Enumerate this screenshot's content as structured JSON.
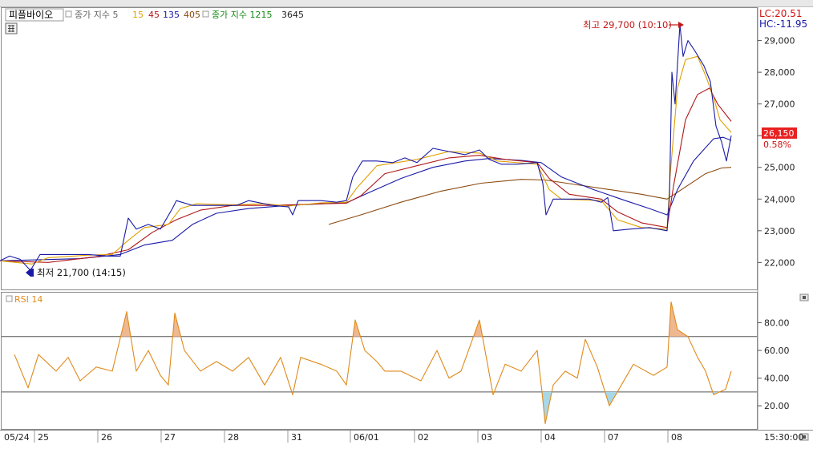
{
  "legend": {
    "toggle_icon": "grid-toggle-icon",
    "filter_label": "피플바이오",
    "sma_label": "종가 지수 5",
    "sma_periods": [
      {
        "value": "15",
        "color": "#e0a000"
      },
      {
        "value": "45",
        "color": "#b01818"
      },
      {
        "value": "135",
        "color": "#1a1aa8"
      },
      {
        "value": "405",
        "color": "#8a4a10"
      }
    ],
    "sma2_label": "종가 지수 1215",
    "sma2_period": "3645"
  },
  "right_panel": {
    "lc": "LC:20.51",
    "hc": "HC:-11.95",
    "current_price": "26,150",
    "current_change": "0.58%"
  },
  "markers": {
    "high": "최고 29,700 (10:10)",
    "low": "최저 21,700 (14:15)"
  },
  "rsi_panel": {
    "label": "RSI 14"
  },
  "time_axis": {
    "end_label": "15:30:00",
    "labels": [
      "05/24",
      "25",
      "26",
      "27",
      "28",
      "31",
      "06/01",
      "02",
      "03",
      "04",
      "07",
      "08"
    ]
  },
  "chart_data": {
    "type": "line",
    "series": [
      {
        "name": "종가",
        "color": "#1a1aa8",
        "points": [
          [
            0,
            22050
          ],
          [
            12,
            22200
          ],
          [
            25,
            22100
          ],
          [
            38,
            21750
          ],
          [
            50,
            22250
          ],
          [
            80,
            22250
          ],
          [
            110,
            22250
          ],
          [
            135,
            22200
          ],
          [
            150,
            22200
          ],
          [
            160,
            23400
          ],
          [
            170,
            23050
          ],
          [
            185,
            23200
          ],
          [
            200,
            23050
          ],
          [
            215,
            23700
          ],
          [
            220,
            23950
          ],
          [
            240,
            23800
          ],
          [
            270,
            23800
          ],
          [
            295,
            23800
          ],
          [
            310,
            23950
          ],
          [
            340,
            23800
          ],
          [
            360,
            23750
          ],
          [
            365,
            23500
          ],
          [
            372,
            23950
          ],
          [
            400,
            23950
          ],
          [
            420,
            23900
          ],
          [
            432,
            23950
          ],
          [
            440,
            24700
          ],
          [
            452,
            25200
          ],
          [
            470,
            25200
          ],
          [
            490,
            25150
          ],
          [
            505,
            25300
          ],
          [
            520,
            25150
          ],
          [
            540,
            25600
          ],
          [
            560,
            25500
          ],
          [
            580,
            25400
          ],
          [
            598,
            25550
          ],
          [
            610,
            25250
          ],
          [
            625,
            25100
          ],
          [
            645,
            25100
          ],
          [
            670,
            25150
          ],
          [
            677,
            24500
          ],
          [
            681,
            23500
          ],
          [
            690,
            24000
          ],
          [
            720,
            24000
          ],
          [
            735,
            24000
          ],
          [
            750,
            23900
          ],
          [
            758,
            24050
          ],
          [
            765,
            23000
          ],
          [
            785,
            23050
          ],
          [
            810,
            23100
          ],
          [
            832,
            23000
          ],
          [
            835,
            24100
          ],
          [
            838,
            28000
          ],
          [
            842,
            27000
          ],
          [
            848,
            29500
          ],
          [
            852,
            28500
          ],
          [
            858,
            29000
          ],
          [
            866,
            28700
          ],
          [
            878,
            28200
          ],
          [
            886,
            27700
          ],
          [
            893,
            26300
          ],
          [
            900,
            25800
          ],
          [
            906,
            25200
          ],
          [
            912,
            26000
          ]
        ]
      },
      {
        "name": "15",
        "color": "#e0a000",
        "points": [
          [
            0,
            22050
          ],
          [
            40,
            21950
          ],
          [
            60,
            22150
          ],
          [
            110,
            22230
          ],
          [
            140,
            22250
          ],
          [
            160,
            22700
          ],
          [
            180,
            23100
          ],
          [
            210,
            23200
          ],
          [
            225,
            23700
          ],
          [
            245,
            23850
          ],
          [
            290,
            23820
          ],
          [
            330,
            23850
          ],
          [
            360,
            23780
          ],
          [
            400,
            23880
          ],
          [
            432,
            23900
          ],
          [
            445,
            24350
          ],
          [
            470,
            25050
          ],
          [
            520,
            25250
          ],
          [
            560,
            25500
          ],
          [
            598,
            25450
          ],
          [
            620,
            25200
          ],
          [
            670,
            25100
          ],
          [
            685,
            24300
          ],
          [
            700,
            24000
          ],
          [
            750,
            23950
          ],
          [
            770,
            23350
          ],
          [
            800,
            23100
          ],
          [
            832,
            23050
          ],
          [
            836,
            24800
          ],
          [
            845,
            27500
          ],
          [
            855,
            28400
          ],
          [
            870,
            28500
          ],
          [
            880,
            27900
          ],
          [
            890,
            27200
          ],
          [
            898,
            26500
          ],
          [
            912,
            26100
          ]
        ]
      },
      {
        "name": "45",
        "color": "#b01818",
        "points": [
          [
            0,
            22050
          ],
          [
            60,
            22000
          ],
          [
            120,
            22180
          ],
          [
            160,
            22400
          ],
          [
            190,
            22950
          ],
          [
            220,
            23350
          ],
          [
            250,
            23650
          ],
          [
            290,
            23800
          ],
          [
            340,
            23800
          ],
          [
            400,
            23850
          ],
          [
            432,
            23870
          ],
          [
            450,
            24100
          ],
          [
            480,
            24800
          ],
          [
            520,
            25050
          ],
          [
            560,
            25300
          ],
          [
            598,
            25380
          ],
          [
            630,
            25250
          ],
          [
            670,
            25150
          ],
          [
            685,
            24650
          ],
          [
            710,
            24150
          ],
          [
            750,
            24000
          ],
          [
            770,
            23600
          ],
          [
            800,
            23250
          ],
          [
            832,
            23100
          ],
          [
            840,
            24400
          ],
          [
            855,
            26500
          ],
          [
            870,
            27300
          ],
          [
            885,
            27500
          ],
          [
            895,
            27000
          ],
          [
            912,
            26450
          ]
        ]
      },
      {
        "name": "135",
        "color": "#1a1aa8",
        "points": [
          [
            0,
            22050
          ],
          [
            100,
            22120
          ],
          [
            150,
            22250
          ],
          [
            180,
            22550
          ],
          [
            215,
            22700
          ],
          [
            240,
            23200
          ],
          [
            270,
            23550
          ],
          [
            310,
            23700
          ],
          [
            360,
            23800
          ],
          [
            400,
            23850
          ],
          [
            432,
            23880
          ],
          [
            460,
            24200
          ],
          [
            500,
            24650
          ],
          [
            540,
            25000
          ],
          [
            580,
            25200
          ],
          [
            610,
            25280
          ],
          [
            650,
            25220
          ],
          [
            675,
            25150
          ],
          [
            700,
            24700
          ],
          [
            740,
            24300
          ],
          [
            780,
            23950
          ],
          [
            810,
            23700
          ],
          [
            832,
            23500
          ],
          [
            845,
            24300
          ],
          [
            865,
            25200
          ],
          [
            890,
            25900
          ],
          [
            902,
            25950
          ],
          [
            912,
            25850
          ]
        ]
      },
      {
        "name": "405",
        "color": "#8a4a10",
        "points": [
          [
            410,
            23200
          ],
          [
            450,
            23500
          ],
          [
            500,
            23900
          ],
          [
            550,
            24250
          ],
          [
            600,
            24500
          ],
          [
            650,
            24620
          ],
          [
            680,
            24600
          ],
          [
            720,
            24450
          ],
          [
            760,
            24300
          ],
          [
            800,
            24150
          ],
          [
            832,
            24000
          ],
          [
            850,
            24300
          ],
          [
            880,
            24800
          ],
          [
            900,
            24980
          ],
          [
            912,
            25000
          ]
        ]
      }
    ],
    "y_axis": {
      "ticks": [
        22000,
        23000,
        24000,
        25000,
        26000,
        27000,
        28000,
        29000
      ],
      "tick_labels": [
        "22,000",
        "23,000",
        "24,000",
        "25,000",
        "26,000",
        "27,000",
        "28,000",
        "29,000"
      ],
      "ylim": [
        21300,
        29900
      ]
    },
    "rsi": {
      "name": "RSI 14",
      "color": "#e08a1a",
      "ylim": [
        5,
        100
      ],
      "overbought": 70,
      "oversold": 30,
      "ticks": [
        20,
        40,
        60,
        80
      ],
      "tick_labels": [
        "20.00",
        "40.00",
        "60.00",
        "80.00"
      ],
      "points": [
        [
          18,
          57
        ],
        [
          35,
          33
        ],
        [
          48,
          57
        ],
        [
          70,
          45
        ],
        [
          85,
          55
        ],
        [
          100,
          38
        ],
        [
          120,
          48
        ],
        [
          140,
          45
        ],
        [
          158,
          88
        ],
        [
          170,
          45
        ],
        [
          185,
          60
        ],
        [
          200,
          42
        ],
        [
          210,
          35
        ],
        [
          218,
          87
        ],
        [
          230,
          60
        ],
        [
          250,
          45
        ],
        [
          270,
          52
        ],
        [
          290,
          45
        ],
        [
          310,
          55
        ],
        [
          330,
          35
        ],
        [
          350,
          55
        ],
        [
          365,
          28
        ],
        [
          375,
          55
        ],
        [
          400,
          50
        ],
        [
          420,
          45
        ],
        [
          432,
          35
        ],
        [
          443,
          82
        ],
        [
          455,
          60
        ],
        [
          470,
          52
        ],
        [
          480,
          45
        ],
        [
          500,
          45
        ],
        [
          525,
          38
        ],
        [
          545,
          60
        ],
        [
          560,
          40
        ],
        [
          575,
          45
        ],
        [
          598,
          82
        ],
        [
          615,
          28
        ],
        [
          630,
          50
        ],
        [
          650,
          45
        ],
        [
          670,
          60
        ],
        [
          676,
          30
        ],
        [
          680,
          7
        ],
        [
          690,
          35
        ],
        [
          705,
          45
        ],
        [
          720,
          40
        ],
        [
          730,
          68
        ],
        [
          745,
          48
        ],
        [
          760,
          20
        ],
        [
          770,
          30
        ],
        [
          790,
          50
        ],
        [
          815,
          42
        ],
        [
          832,
          48
        ],
        [
          837,
          95
        ],
        [
          845,
          75
        ],
        [
          858,
          70
        ],
        [
          870,
          55
        ],
        [
          880,
          45
        ],
        [
          890,
          28
        ],
        [
          905,
          32
        ],
        [
          912,
          45
        ]
      ]
    },
    "x_labels": [
      "05/24",
      "25",
      "26",
      "27",
      "28",
      "31",
      "06/01",
      "02",
      "03",
      "04",
      "07",
      "08",
      "15:30:00"
    ],
    "grid": false
  }
}
